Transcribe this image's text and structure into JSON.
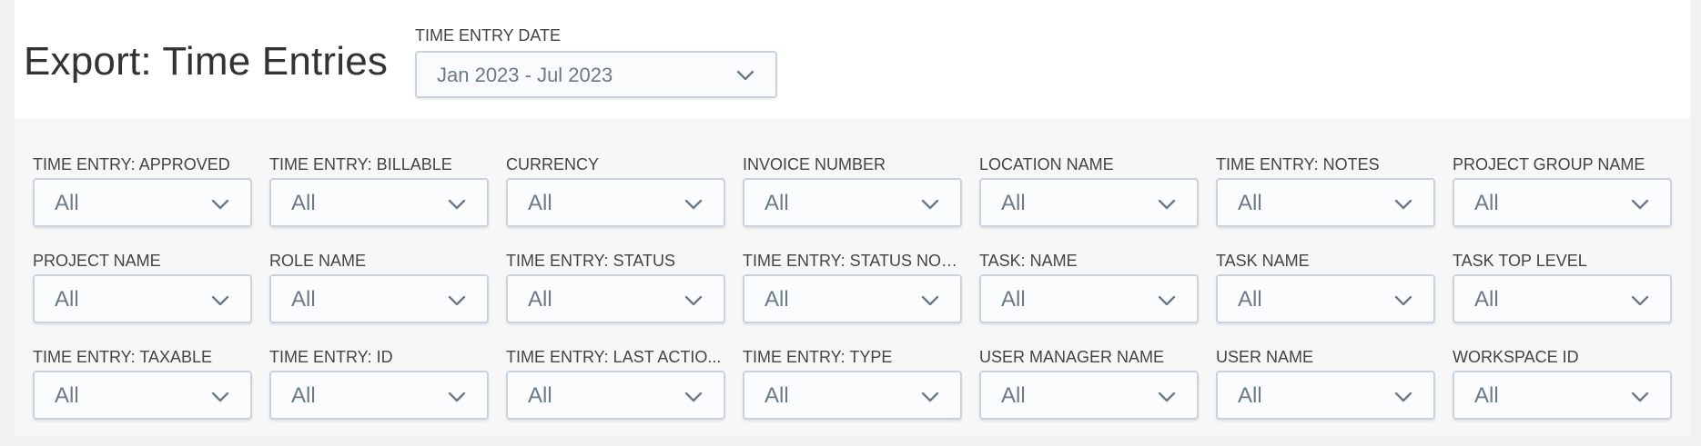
{
  "header": {
    "title": "Export: Time Entries",
    "date_filter": {
      "label": "TIME ENTRY DATE",
      "value": "Jan 2023 - Jul 2023"
    }
  },
  "filters": [
    {
      "label": "TIME ENTRY: APPROVED",
      "value": "All"
    },
    {
      "label": "TIME ENTRY: BILLABLE",
      "value": "All"
    },
    {
      "label": "CURRENCY",
      "value": "All"
    },
    {
      "label": "INVOICE NUMBER",
      "value": "All"
    },
    {
      "label": "LOCATION NAME",
      "value": "All"
    },
    {
      "label": "TIME ENTRY: NOTES",
      "value": "All"
    },
    {
      "label": "PROJECT GROUP NAME",
      "value": "All"
    },
    {
      "label": "PROJECT NAME",
      "value": "All"
    },
    {
      "label": "ROLE NAME",
      "value": "All"
    },
    {
      "label": "TIME ENTRY: STATUS",
      "value": "All"
    },
    {
      "label": "TIME ENTRY: STATUS NOTE",
      "value": "All"
    },
    {
      "label": "TASK: NAME",
      "value": "All"
    },
    {
      "label": "TASK NAME",
      "value": "All"
    },
    {
      "label": "TASK TOP LEVEL",
      "value": "All"
    },
    {
      "label": "TIME ENTRY: TAXABLE",
      "value": "All"
    },
    {
      "label": "TIME ENTRY: ID",
      "value": "All"
    },
    {
      "label": "TIME ENTRY: LAST ACTIO...",
      "value": "All"
    },
    {
      "label": "TIME ENTRY: TYPE",
      "value": "All"
    },
    {
      "label": "USER MANAGER NAME",
      "value": "All"
    },
    {
      "label": "USER NAME",
      "value": "All"
    },
    {
      "label": "WORKSPACE ID",
      "value": "All"
    }
  ],
  "icons": {
    "dropdown": "chevron-down-icon"
  },
  "colors": {
    "title": "#333333",
    "label": "#444444",
    "select_text": "#6c7a89",
    "select_border": "#c9d3dd",
    "panel_background": "#f7f7f7"
  }
}
